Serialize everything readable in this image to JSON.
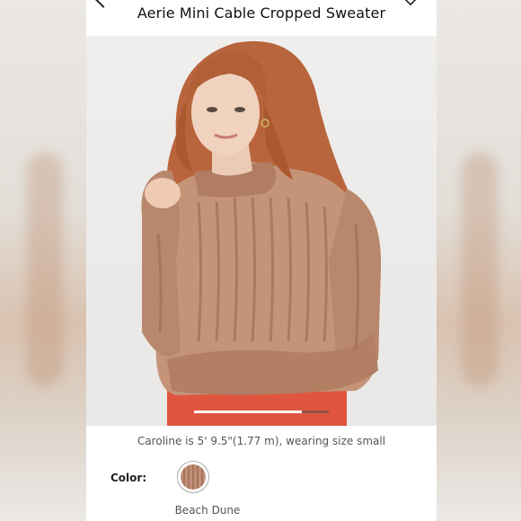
{
  "product": {
    "title": "Aerie Mini Cable Cropped Sweater"
  },
  "gallery": {
    "progress": 0.8
  },
  "model_caption": "Caroline is 5' 9.5\"(1.77 m), wearing size small",
  "color": {
    "label": "Color:",
    "selected": "Beach Dune",
    "swatch_hex": "#b78269"
  },
  "icons": {
    "back": "chevron-left-icon",
    "favorite": "heart-icon"
  }
}
